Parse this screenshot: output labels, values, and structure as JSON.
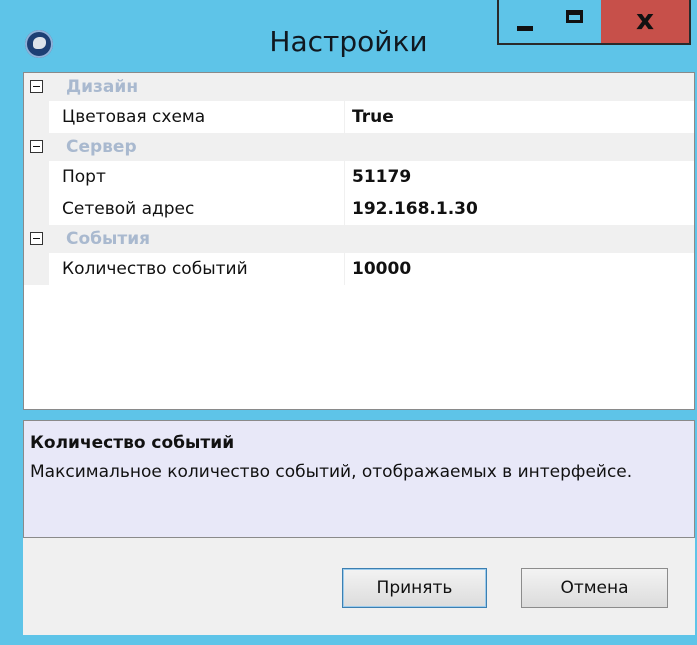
{
  "window": {
    "title": "Настройки",
    "controls": {
      "minimize": "_",
      "maximize": "□",
      "close": "x"
    },
    "colors": {
      "frame": "#5ec4e8",
      "close": "#c7504a"
    }
  },
  "categories": [
    {
      "label": "Дизайн",
      "toggle": "minus",
      "properties": [
        {
          "name": "Цветовая схема",
          "value": "True"
        }
      ]
    },
    {
      "label": "Сервер",
      "toggle": "minus",
      "properties": [
        {
          "name": "Порт",
          "value": "51179"
        },
        {
          "name": "Сетевой адрес",
          "value": "192.168.1.30"
        }
      ]
    },
    {
      "label": "События",
      "toggle": "minus",
      "properties": [
        {
          "name": "Количество событий",
          "value": "10000"
        }
      ]
    }
  ],
  "description": {
    "title": "Количество событий",
    "text": "Максимальное количество событий, отображаемых в интерфейсе."
  },
  "buttons": {
    "ok": "Принять",
    "cancel": "Отмена"
  }
}
